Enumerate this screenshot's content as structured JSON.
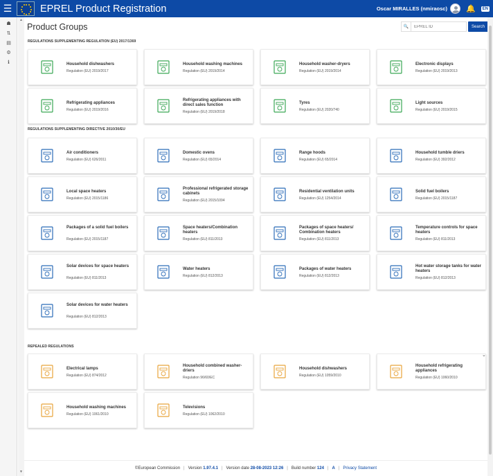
{
  "app": {
    "title": "EPREL Product Registration",
    "user": "Oscar MIRALLES (nmiraosc)",
    "lang": "EN"
  },
  "page": {
    "title": "Product Groups"
  },
  "search": {
    "placeholder": "EPREL ID",
    "button": "Search"
  },
  "sections": [
    {
      "title": "REGULATIONS SUPPLEMENTING REGULATION (EU) 2017/1369",
      "color": "#3aa655",
      "cards": [
        {
          "name": "Household dishwashers",
          "reg": "Regulation (EU) 2019/2017",
          "icon": "dishwasher-icon"
        },
        {
          "name": "Household washing machines",
          "reg": "Regulation (EU) 2019/2014",
          "icon": "washing-machine-icon"
        },
        {
          "name": "Household washer-dryers",
          "reg": "Regulation (EU) 2019/2014",
          "icon": "washer-dryer-icon"
        },
        {
          "name": "Electronic displays",
          "reg": "Regulation (EU) 2019/2013",
          "icon": "display-icon"
        },
        {
          "name": "Refrigerating appliances",
          "reg": "Regulation (EU) 2019/2016",
          "icon": "fridge-icon"
        },
        {
          "name": "Refrigerating appliances with direct sales function",
          "reg": "Regulation (EU) 2019/2018",
          "icon": "sales-fridge-icon"
        },
        {
          "name": "Tyres",
          "reg": "Regulation (EU) 2020/740",
          "icon": "tyre-icon"
        },
        {
          "name": "Light sources",
          "reg": "Regulation (EU) 2019/2015",
          "icon": "bulb-icon"
        }
      ]
    },
    {
      "title": "REGULATIONS SUPPLEMENTING DIRECTIVE 2010/30/EU",
      "color": "#2b6cb8",
      "cards": [
        {
          "name": "Air conditioners",
          "reg": "Regulation (EU) 626/2011",
          "icon": "air-conditioner-icon"
        },
        {
          "name": "Domestic ovens",
          "reg": "Regulation (EU) 65/2014",
          "icon": "oven-icon"
        },
        {
          "name": "Range hoods",
          "reg": "Regulation (EU) 65/2014",
          "icon": "range-hood-icon"
        },
        {
          "name": "Household tumble driers",
          "reg": "Regulation (EU) 392/2012",
          "icon": "tumble-drier-icon"
        },
        {
          "name": "Local space heaters",
          "reg": "Regulation (EU) 2015/1186",
          "icon": "space-heater-icon"
        },
        {
          "name": "Professional refrigerated storage cabinets",
          "reg": "Regulation (EU) 2015/1094",
          "icon": "storage-cabinet-icon"
        },
        {
          "name": "Residential ventilation units",
          "reg": "Regulation (EU) 1254/2014",
          "icon": "ventilation-icon"
        },
        {
          "name": "Solid fuel boilers",
          "reg": "Regulation (EU) 2015/1187",
          "icon": "solid-fuel-boiler-icon"
        },
        {
          "name": "Packages of a solid fuel boilers",
          "reg": "Regulation (EU) 2015/1187",
          "icon": "boiler-package-icon"
        },
        {
          "name": "Space heaters/Combination heaters",
          "reg": "Regulation (EU) 811/2013",
          "icon": "combination-heater-icon"
        },
        {
          "name": "Packages of space heaters/ Combination heaters",
          "reg": "Regulation (EU) 811/2013",
          "icon": "heater-package-icon"
        },
        {
          "name": "Temperature controls for space heaters",
          "reg": "Regulation (EU) 811/2013",
          "icon": "temperature-control-icon"
        },
        {
          "name": "Solar devices for space heaters",
          "reg": "Regulation (EU) 811/2013",
          "icon": "solar-space-icon"
        },
        {
          "name": "Water heaters",
          "reg": "Regulation (EU) 812/2013",
          "icon": "water-heater-icon"
        },
        {
          "name": "Packages of water heaters",
          "reg": "Regulation (EU) 812/2013",
          "icon": "water-heater-package-icon"
        },
        {
          "name": "Hot water storage tanks for water heaters",
          "reg": "Regulation (EU) 812/2013",
          "icon": "storage-tank-icon"
        },
        {
          "name": "Solar devices for water heaters",
          "reg": "Regulation (EU) 812/2013",
          "icon": "solar-water-icon"
        }
      ]
    },
    {
      "title": "REPEALED REGULATIONS",
      "color": "#e8a33a",
      "cards": [
        {
          "name": "Electrical lamps",
          "reg": "Regulation (EU) 874/2012",
          "icon": "lamp-icon"
        },
        {
          "name": "Household combined washer-driers",
          "reg": "Regulation 96/60/EC",
          "icon": "washer-drier-icon"
        },
        {
          "name": "Household dishwashers",
          "reg": "Regulation (EU) 1059/2010",
          "icon": "dishwasher-icon"
        },
        {
          "name": "Household refrigerating appliances",
          "reg": "Regulation (EU) 1060/2010",
          "icon": "fridge-icon"
        },
        {
          "name": "Household washing machines",
          "reg": "Regulation (EU) 1061/2010",
          "icon": "washing-machine-icon"
        },
        {
          "name": "Televisions",
          "reg": "Regulation (EU) 1062/2010",
          "icon": "television-icon"
        }
      ]
    }
  ],
  "footer": {
    "copyright": "European Commission",
    "version_label": "Version",
    "version": "1.97.4.1",
    "date_label": "Version date",
    "date": "28-08-2023 12:26",
    "build_label": "Build number",
    "build": "124",
    "a": "A",
    "privacy": "Privacy Statement"
  }
}
